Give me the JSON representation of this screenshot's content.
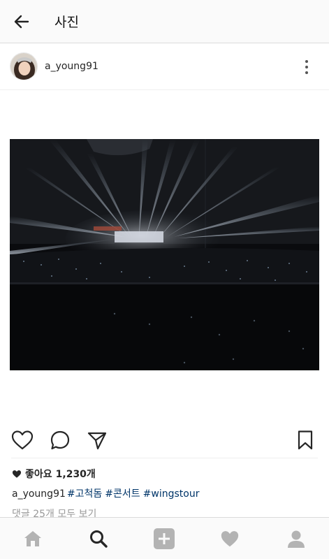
{
  "topbar": {
    "title": "사진",
    "back_icon": "arrow-left-icon"
  },
  "post": {
    "username": "a_young91",
    "more_icon": "more-vertical-icon",
    "photo_subject": "concert-arena-photo"
  },
  "actions": {
    "like_icon": "heart-outline-icon",
    "comment_icon": "comment-bubble-icon",
    "share_icon": "send-paper-plane-icon",
    "save_icon": "bookmark-icon"
  },
  "likes": {
    "icon": "heart-filled-icon",
    "label": "좋아요",
    "count": "1,230개"
  },
  "caption": {
    "username": "a_young91",
    "hashtags": [
      "#고척돔",
      "#콘서트",
      "#wingstour"
    ]
  },
  "comments": {
    "link_text": "댓글 25개 모두 보기"
  },
  "bottom_nav": {
    "items": [
      "home-icon",
      "search-icon",
      "add-post-icon",
      "activity-heart-icon",
      "profile-icon"
    ],
    "active": "search-icon"
  },
  "colors": {
    "hashtag": "#003569",
    "muted": "#999999",
    "text": "#262626",
    "bar_bg": "#fafafa"
  }
}
